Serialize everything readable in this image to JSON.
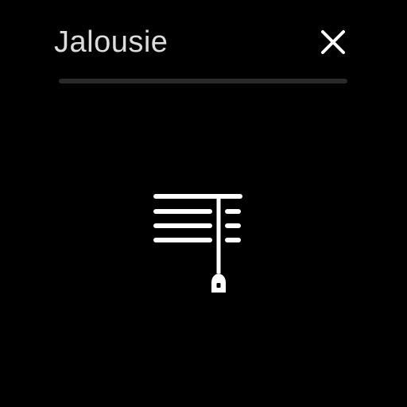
{
  "header": {
    "title": "Jalousie",
    "close_icon": "close-icon"
  },
  "main": {
    "icon": "window-blind-icon"
  },
  "colors": {
    "background": "#000000",
    "title_text": "#dcdcdc",
    "icon": "#ffffff",
    "divider": "#2a2a2a"
  }
}
